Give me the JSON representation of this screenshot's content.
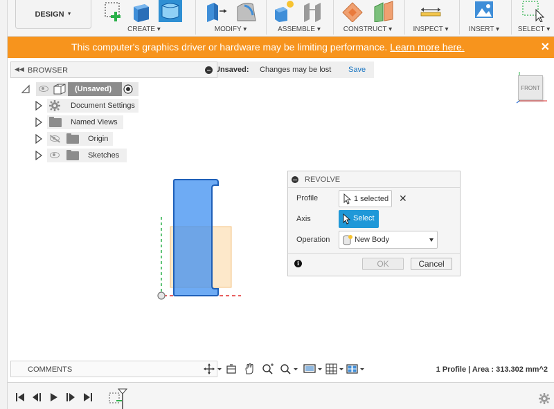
{
  "toolbar": {
    "design_label": "DESIGN",
    "groups": [
      {
        "label": "CREATE"
      },
      {
        "label": "MODIFY"
      },
      {
        "label": "ASSEMBLE"
      },
      {
        "label": "CONSTRUCT"
      },
      {
        "label": "INSPECT"
      },
      {
        "label": "INSERT"
      },
      {
        "label": "SELECT"
      }
    ]
  },
  "banner": {
    "message": "This computer's graphics driver or hardware may be limiting performance.",
    "link": "Learn more here.",
    "close": "✕",
    "color": "#f7941d"
  },
  "unsaved_bar": {
    "label": "Unsaved:",
    "message": "Changes may be lost",
    "save": "Save"
  },
  "browser": {
    "title": "BROWSER",
    "root": "(Unsaved)",
    "items": [
      {
        "label": "Document Settings",
        "icon": "gear-icon"
      },
      {
        "label": "Named Views",
        "icon": "folder-icon"
      },
      {
        "label": "Origin",
        "icon": "folder-icon",
        "visibility": "hidden"
      },
      {
        "label": "Sketches",
        "icon": "folder-icon",
        "visibility": "visible"
      }
    ]
  },
  "viewcube": {
    "face": "FRONT"
  },
  "revolve": {
    "title": "REVOLVE",
    "profile_label": "Profile",
    "profile_value": "1 selected",
    "axis_label": "Axis",
    "axis_button": "Select",
    "operation_label": "Operation",
    "operation_value": "New Body",
    "ok": "OK",
    "cancel": "Cancel",
    "accent": "#1f98d8"
  },
  "comments": {
    "title": "COMMENTS"
  },
  "status": {
    "text": "1 Profile | Area : 313.302 mm^2"
  }
}
